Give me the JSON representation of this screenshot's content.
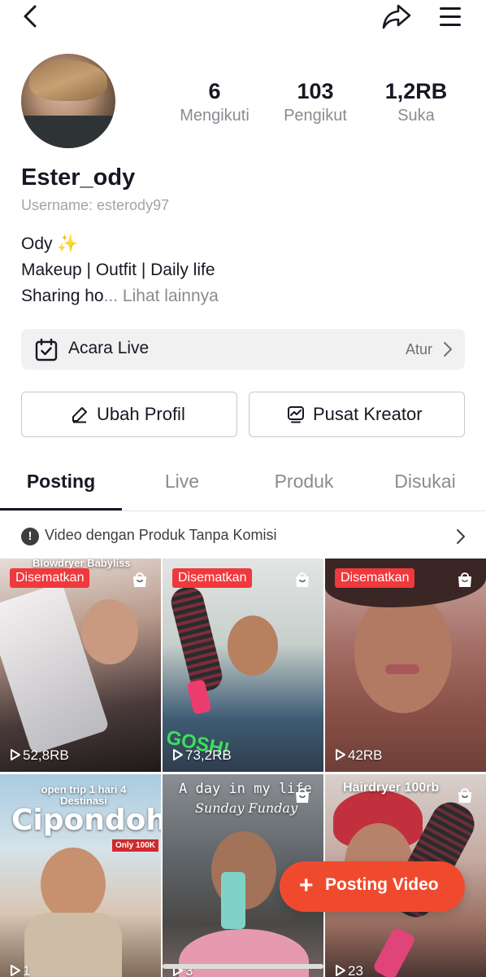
{
  "profile": {
    "username": "Ester_ody",
    "handle": "Username: esterody97",
    "bio_line1": "Ody",
    "bio_emoji": "✨",
    "bio_line2": "Makeup | Outfit | Daily life",
    "bio_line3": "Sharing ho",
    "bio_more": "... Lihat lainnya"
  },
  "stats": [
    {
      "value": "6",
      "label": "Mengikuti"
    },
    {
      "value": "103",
      "label": "Pengikut"
    },
    {
      "value": "1,2RB",
      "label": "Suka"
    }
  ],
  "live_events": {
    "label": "Acara Live",
    "action": "Atur"
  },
  "buttons": {
    "edit_profile": "Ubah Profil",
    "creator_center": "Pusat Kreator"
  },
  "tabs": [
    "Posting",
    "Live",
    "Produk",
    "Disukai"
  ],
  "active_tab": "Posting",
  "notice": "Video dengan Produk Tanpa Komisi",
  "videos": [
    {
      "pinned": "Disematkan",
      "views": "52,8RB",
      "overlay": "Blowdryer Babyliss"
    },
    {
      "pinned": "Disematkan",
      "views": "73,2RB",
      "overlay": ""
    },
    {
      "pinned": "Disematkan",
      "views": "42RB",
      "overlay": ""
    },
    {
      "pinned": "",
      "views": "1",
      "overlay": "open trip 1 hari 4 Destinasi",
      "overlay2": "Cipondoh",
      "overlay3": "Only 100K"
    },
    {
      "pinned": "",
      "views": "3",
      "overlay": "A day in my life",
      "overlay2": "Sunday Funday"
    },
    {
      "pinned": "",
      "views": "23",
      "overlay": "Hairdryer 100rb"
    }
  ],
  "fab": {
    "label": "Posting Video"
  },
  "colors": {
    "accent": "#f04a2e",
    "pinned_badge": "#f0393d",
    "text": "#161823",
    "muted": "#8a8b91"
  }
}
